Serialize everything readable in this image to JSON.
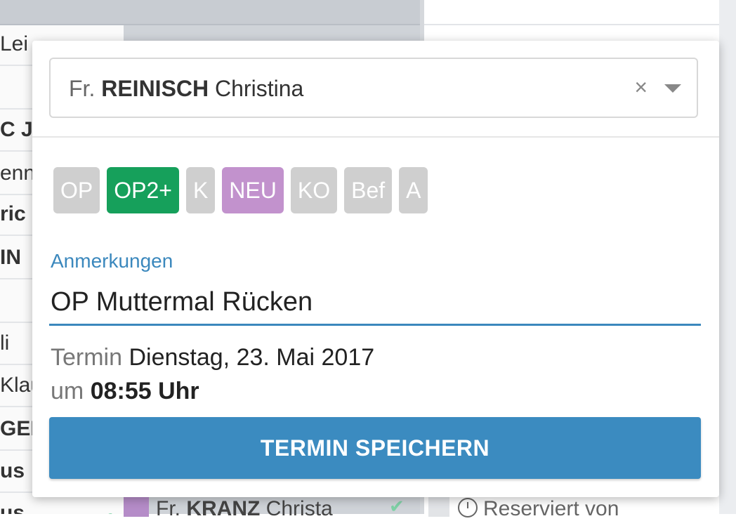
{
  "background": {
    "name_rows": [
      {
        "text": "Lei",
        "bold": false,
        "check": true
      },
      {
        "text": "",
        "bold": false,
        "check": false
      },
      {
        "text": "C Je",
        "bold": true,
        "check": false
      },
      {
        "text": "enni",
        "bold": false,
        "check": false
      },
      {
        "text": "ric",
        "bold": true,
        "check": false
      },
      {
        "text": "IN",
        "bold": true,
        "check": false
      },
      {
        "text": "",
        "bold": false,
        "check": false
      },
      {
        "text": "li",
        "bold": false,
        "check": false
      },
      {
        "text": "Klau",
        "bold": false,
        "check": false
      },
      {
        "text": "GER",
        "bold": true,
        "check": false
      },
      {
        "text": "us",
        "bold": true,
        "check": false
      },
      {
        "text": "us",
        "bold": true,
        "check": true
      }
    ],
    "bottom_row": {
      "salutation": "Fr.",
      "last_name": "KRANZ",
      "first_name": "Christa",
      "reserved_text": "Reserviert von"
    }
  },
  "popup": {
    "patient": {
      "salutation": "Fr.",
      "last_name": "REINISCH",
      "first_name": "Christina",
      "clear_icon": "×"
    },
    "tags": [
      {
        "label": "OP",
        "active": false,
        "color": "#cfcfcf"
      },
      {
        "label": "OP2+",
        "active": true,
        "color": "#16a05b"
      },
      {
        "label": "K",
        "active": false,
        "color": "#cfcfcf"
      },
      {
        "label": "NEU",
        "active": true,
        "color": "#c292cd"
      },
      {
        "label": "KO",
        "active": false,
        "color": "#cfcfcf"
      },
      {
        "label": "Bef",
        "active": false,
        "color": "#cfcfcf"
      },
      {
        "label": "A",
        "active": false,
        "color": "#cfcfcf"
      }
    ],
    "notes": {
      "label": "Anmerkungen",
      "value": "OP Muttermal Rücken"
    },
    "appointment": {
      "date_label": "Termin",
      "date_value": "Dienstag, 23. Mai 2017",
      "time_label": "um",
      "time_value": "08:55 Uhr"
    },
    "save_button": "TERMIN SPEICHERN"
  },
  "colors": {
    "accent": "#3b88bd",
    "tag_green": "#16a05b",
    "tag_purple": "#c292cd",
    "tag_inactive": "#cfcfcf"
  }
}
